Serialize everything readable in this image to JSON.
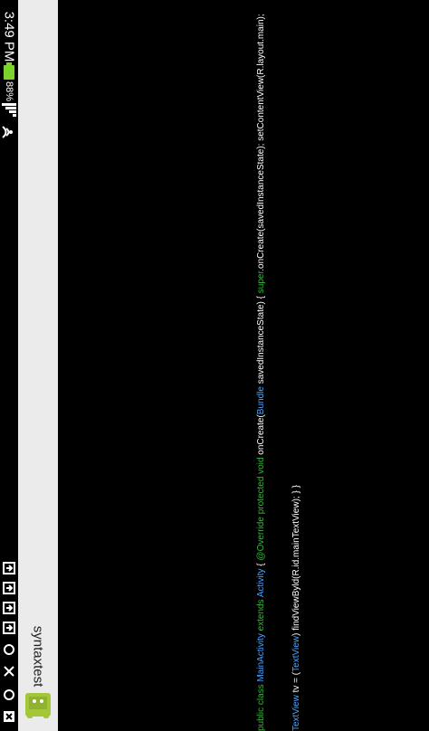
{
  "status": {
    "time": "3:49 PM",
    "battery_pct": "88%",
    "battery_color": "#7bd32b"
  },
  "app": {
    "title": "syntaxtest"
  },
  "code": {
    "line1": [
      {
        "t": "public class ",
        "c": "kw"
      },
      {
        "t": "MainActivity ",
        "c": "ty"
      },
      {
        "t": "extends ",
        "c": "kw"
      },
      {
        "t": "Activity",
        "c": "ty"
      },
      {
        "t": " { ",
        "c": ""
      },
      {
        "t": "@Override protected void ",
        "c": "kw"
      },
      {
        "t": "onCreate(",
        "c": ""
      },
      {
        "t": "Bundle",
        "c": "ty"
      },
      {
        "t": " savedInstanceState) { ",
        "c": ""
      },
      {
        "t": "super",
        "c": "kw"
      },
      {
        "t": ".onCreate(savedInstanceState); setContentView(R.layout.main);",
        "c": ""
      }
    ],
    "line2": [
      {
        "t": "TextView",
        "c": "ty"
      },
      {
        "t": " tv = (",
        "c": ""
      },
      {
        "t": "TextView",
        "c": "ty"
      },
      {
        "t": ") findViewByld(R.id.mainTextView); } }",
        "c": ""
      }
    ]
  }
}
